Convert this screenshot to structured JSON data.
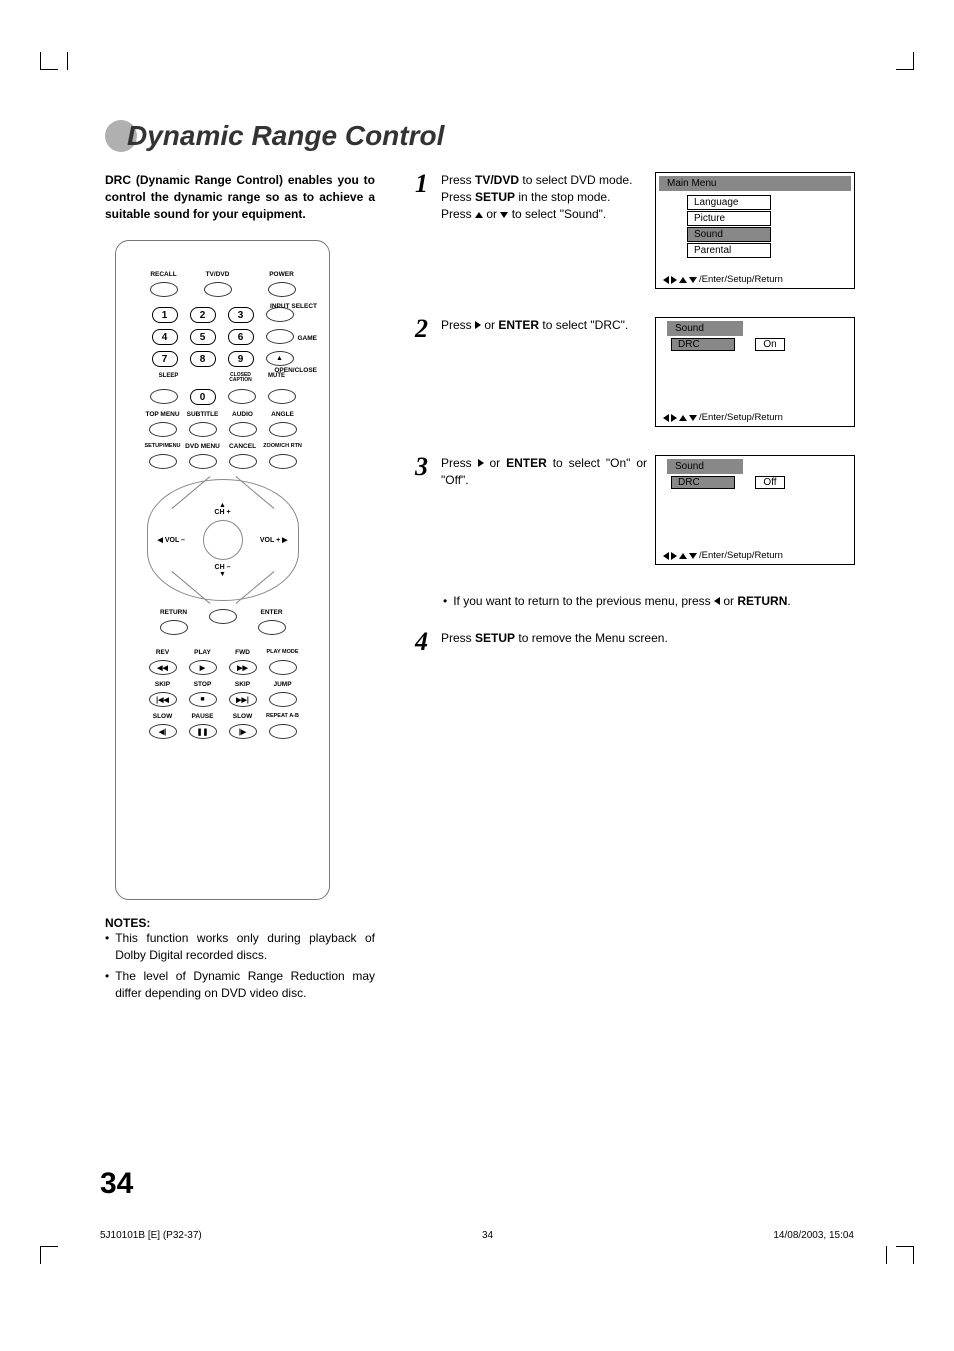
{
  "page_title": "Dynamic Range Control",
  "intro": "DRC (Dynamic Range Control) enables you to control the dynamic range so as to achieve a suitable sound for your equipment.",
  "remote": {
    "top_row": {
      "recall": "RECALL",
      "tvdvd": "TV/DVD",
      "power": "POWER"
    },
    "side_labels": {
      "input_select": "INPUT SELECT",
      "game": "GAME",
      "open_close": "OPEN/CLOSE"
    },
    "numbers": [
      "1",
      "2",
      "3",
      "4",
      "5",
      "6",
      "7",
      "8",
      "9",
      "0"
    ],
    "under_numbers": {
      "sleep": "SLEEP",
      "closed_caption": "CLOSED\nCAPTION",
      "mute": "MUTE"
    },
    "row_labels": {
      "top_menu": "TOP MENU",
      "subtitle": "SUBTITLE",
      "audio": "AUDIO",
      "angle": "ANGLE"
    },
    "row_labels2": {
      "setup_menu": "SETUP/MENU",
      "dvd_menu": "DVD MENU",
      "cancel": "CANCEL",
      "zoom": "ZOOM/CH RTN"
    },
    "dpad": {
      "ch_up": "CH +",
      "ch_down": "CH –",
      "vol_down": "VOL –",
      "vol_up": "VOL +",
      "return": "RETURN",
      "enter": "ENTER"
    },
    "transport": {
      "rev": "REV",
      "play": "PLAY",
      "fwd": "FWD",
      "play_mode": "PLAY MODE",
      "skip_b": "SKIP",
      "stop": "STOP",
      "skip_f": "SKIP",
      "jump": "JUMP",
      "slow_b": "SLOW",
      "pause": "PAUSE",
      "slow_f": "SLOW",
      "repeat": "REPEAT A-B"
    }
  },
  "steps": {
    "s1": {
      "num": "1",
      "line1a": "Press ",
      "line1b": "TV/DVD",
      "line1c": " to select DVD mode.",
      "line2a": "Press ",
      "line2b": "SETUP",
      "line2c": " in the stop mode.",
      "line3a": "Press ",
      "line3b": " or ",
      "line3c": " to select \"Sound\".",
      "menu": {
        "title": "Main Menu",
        "items": [
          "Language",
          "Picture",
          "Sound",
          "Parental"
        ],
        "selected_index": 2,
        "footer": "/Enter/Setup/Return"
      }
    },
    "s2": {
      "num": "2",
      "text_a": "Press ",
      "text_b": " or ",
      "text_c": "ENTER",
      "text_d": " to select \"DRC\".",
      "menu": {
        "title": "Sound",
        "row_label": "DRC",
        "row_value": "On",
        "footer": "/Enter/Setup/Return"
      }
    },
    "s3": {
      "num": "3",
      "text_a": "Press ",
      "text_b": " or ",
      "text_c": "ENTER",
      "text_d": " to select \"On\" or \"Off\".",
      "menu": {
        "title": "Sound",
        "row_label": "DRC",
        "row_value": "Off",
        "footer": "/Enter/Setup/Return"
      }
    },
    "note_between": {
      "bullet": "•",
      "text_a": "If you want to return to the previous menu, press ",
      "text_b": " or ",
      "text_c": "RETURN",
      "text_d": "."
    },
    "s4": {
      "num": "4",
      "text_a": "Press ",
      "text_b": "SETUP",
      "text_c": " to remove the Menu screen."
    }
  },
  "notes": {
    "heading": "NOTES:",
    "items": [
      "This function works only during playback of Dolby Digital recorded discs.",
      "The level of Dynamic Range Reduction may differ depending on DVD video disc."
    ]
  },
  "page_number": "34",
  "footer": {
    "left": "5J10101B [E] (P32-37)",
    "center": "34",
    "right": "14/08/2003, 15:04"
  }
}
